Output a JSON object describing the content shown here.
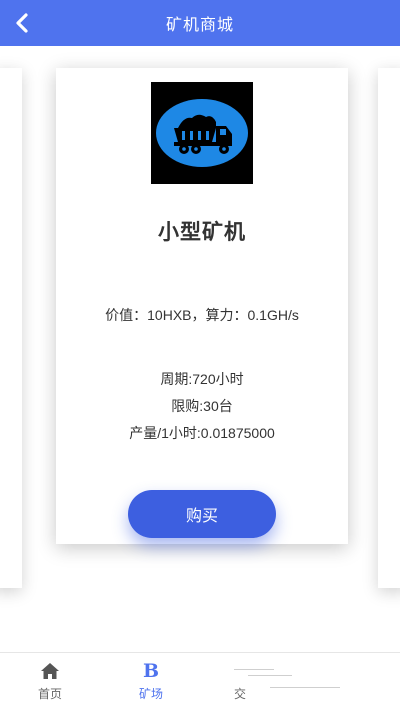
{
  "header": {
    "title": "矿机商城",
    "back_icon": "chevron-left-icon"
  },
  "product": {
    "image_icon": "dump-truck-icon",
    "name": "小型矿机",
    "value_line": "价值：10HXB，算力：0.1GH/s",
    "period": "周期:720小时",
    "limit": "限购:30台",
    "output": "产量/1小时:0.01875000",
    "buy_label": "购买"
  },
  "tabbar": {
    "items": [
      {
        "label": "首页",
        "icon": "home-icon",
        "active": false
      },
      {
        "label": "矿场",
        "icon": "b-glyph-icon",
        "glyph": "B",
        "active": true
      },
      {
        "label": "交",
        "icon": "exchange-icon",
        "active": false
      }
    ]
  },
  "colors": {
    "primary": "#4f73ee",
    "button": "#3d5fe0",
    "thumb_bg": "#000000",
    "thumb_circle": "#1e88e5"
  }
}
